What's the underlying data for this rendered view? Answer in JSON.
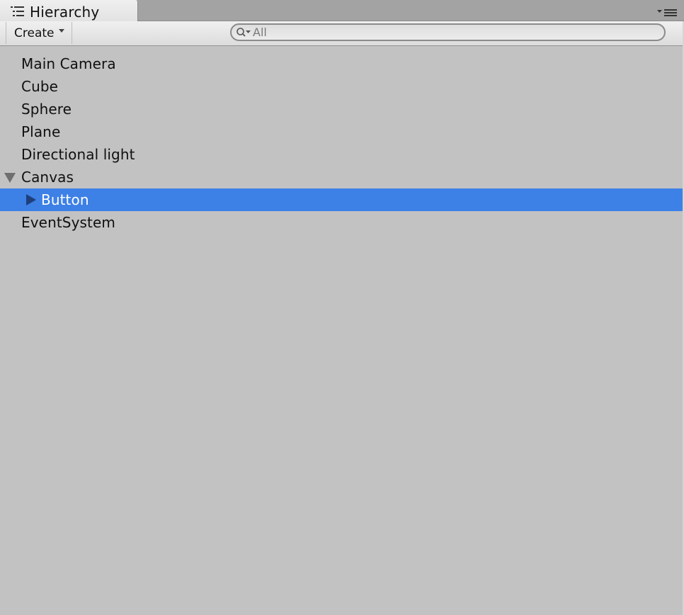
{
  "window": {
    "tab_title": "Hierarchy",
    "tab_icon": "hierarchy-list-icon",
    "panel_menu_icon": "panel-menu-icon"
  },
  "toolbar": {
    "create_label": "Create",
    "search_placeholder": "All",
    "search_value": ""
  },
  "hierarchy": {
    "items": [
      {
        "label": "Main Camera",
        "depth": 0,
        "expanded": null,
        "selected": false
      },
      {
        "label": "Cube",
        "depth": 0,
        "expanded": null,
        "selected": false
      },
      {
        "label": "Sphere",
        "depth": 0,
        "expanded": null,
        "selected": false
      },
      {
        "label": "Plane",
        "depth": 0,
        "expanded": null,
        "selected": false
      },
      {
        "label": "Directional light",
        "depth": 0,
        "expanded": null,
        "selected": false
      },
      {
        "label": "Canvas",
        "depth": 0,
        "expanded": true,
        "selected": false
      },
      {
        "label": "Button",
        "depth": 1,
        "expanded": false,
        "selected": true
      },
      {
        "label": "EventSystem",
        "depth": 0,
        "expanded": null,
        "selected": false
      }
    ]
  },
  "colors": {
    "background": "#c2c2c2",
    "selection": "#3d80e6",
    "selected_text": "#ffffff",
    "text": "#101010"
  }
}
